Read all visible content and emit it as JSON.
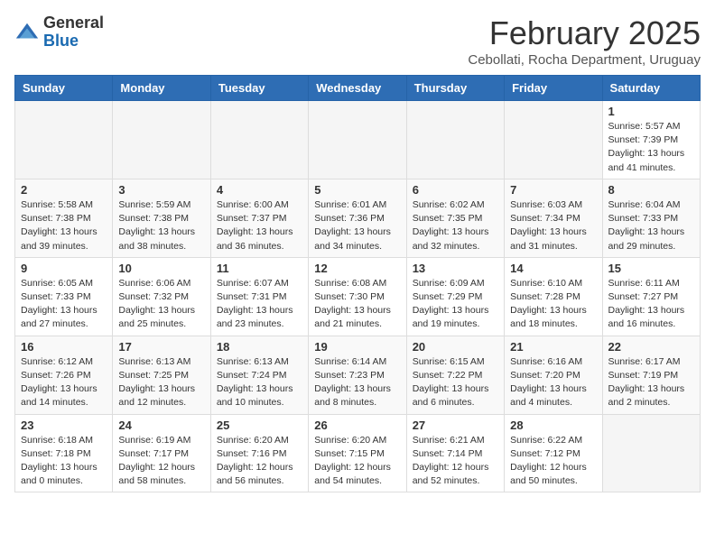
{
  "logo": {
    "general": "General",
    "blue": "Blue"
  },
  "header": {
    "title": "February 2025",
    "subtitle": "Cebollati, Rocha Department, Uruguay"
  },
  "weekdays": [
    "Sunday",
    "Monday",
    "Tuesday",
    "Wednesday",
    "Thursday",
    "Friday",
    "Saturday"
  ],
  "weeks": [
    [
      {
        "day": "",
        "info": ""
      },
      {
        "day": "",
        "info": ""
      },
      {
        "day": "",
        "info": ""
      },
      {
        "day": "",
        "info": ""
      },
      {
        "day": "",
        "info": ""
      },
      {
        "day": "",
        "info": ""
      },
      {
        "day": "1",
        "info": "Sunrise: 5:57 AM\nSunset: 7:39 PM\nDaylight: 13 hours\nand 41 minutes."
      }
    ],
    [
      {
        "day": "2",
        "info": "Sunrise: 5:58 AM\nSunset: 7:38 PM\nDaylight: 13 hours\nand 39 minutes."
      },
      {
        "day": "3",
        "info": "Sunrise: 5:59 AM\nSunset: 7:38 PM\nDaylight: 13 hours\nand 38 minutes."
      },
      {
        "day": "4",
        "info": "Sunrise: 6:00 AM\nSunset: 7:37 PM\nDaylight: 13 hours\nand 36 minutes."
      },
      {
        "day": "5",
        "info": "Sunrise: 6:01 AM\nSunset: 7:36 PM\nDaylight: 13 hours\nand 34 minutes."
      },
      {
        "day": "6",
        "info": "Sunrise: 6:02 AM\nSunset: 7:35 PM\nDaylight: 13 hours\nand 32 minutes."
      },
      {
        "day": "7",
        "info": "Sunrise: 6:03 AM\nSunset: 7:34 PM\nDaylight: 13 hours\nand 31 minutes."
      },
      {
        "day": "8",
        "info": "Sunrise: 6:04 AM\nSunset: 7:33 PM\nDaylight: 13 hours\nand 29 minutes."
      }
    ],
    [
      {
        "day": "9",
        "info": "Sunrise: 6:05 AM\nSunset: 7:33 PM\nDaylight: 13 hours\nand 27 minutes."
      },
      {
        "day": "10",
        "info": "Sunrise: 6:06 AM\nSunset: 7:32 PM\nDaylight: 13 hours\nand 25 minutes."
      },
      {
        "day": "11",
        "info": "Sunrise: 6:07 AM\nSunset: 7:31 PM\nDaylight: 13 hours\nand 23 minutes."
      },
      {
        "day": "12",
        "info": "Sunrise: 6:08 AM\nSunset: 7:30 PM\nDaylight: 13 hours\nand 21 minutes."
      },
      {
        "day": "13",
        "info": "Sunrise: 6:09 AM\nSunset: 7:29 PM\nDaylight: 13 hours\nand 19 minutes."
      },
      {
        "day": "14",
        "info": "Sunrise: 6:10 AM\nSunset: 7:28 PM\nDaylight: 13 hours\nand 18 minutes."
      },
      {
        "day": "15",
        "info": "Sunrise: 6:11 AM\nSunset: 7:27 PM\nDaylight: 13 hours\nand 16 minutes."
      }
    ],
    [
      {
        "day": "16",
        "info": "Sunrise: 6:12 AM\nSunset: 7:26 PM\nDaylight: 13 hours\nand 14 minutes."
      },
      {
        "day": "17",
        "info": "Sunrise: 6:13 AM\nSunset: 7:25 PM\nDaylight: 13 hours\nand 12 minutes."
      },
      {
        "day": "18",
        "info": "Sunrise: 6:13 AM\nSunset: 7:24 PM\nDaylight: 13 hours\nand 10 minutes."
      },
      {
        "day": "19",
        "info": "Sunrise: 6:14 AM\nSunset: 7:23 PM\nDaylight: 13 hours\nand 8 minutes."
      },
      {
        "day": "20",
        "info": "Sunrise: 6:15 AM\nSunset: 7:22 PM\nDaylight: 13 hours\nand 6 minutes."
      },
      {
        "day": "21",
        "info": "Sunrise: 6:16 AM\nSunset: 7:20 PM\nDaylight: 13 hours\nand 4 minutes."
      },
      {
        "day": "22",
        "info": "Sunrise: 6:17 AM\nSunset: 7:19 PM\nDaylight: 13 hours\nand 2 minutes."
      }
    ],
    [
      {
        "day": "23",
        "info": "Sunrise: 6:18 AM\nSunset: 7:18 PM\nDaylight: 13 hours\nand 0 minutes."
      },
      {
        "day": "24",
        "info": "Sunrise: 6:19 AM\nSunset: 7:17 PM\nDaylight: 12 hours\nand 58 minutes."
      },
      {
        "day": "25",
        "info": "Sunrise: 6:20 AM\nSunset: 7:16 PM\nDaylight: 12 hours\nand 56 minutes."
      },
      {
        "day": "26",
        "info": "Sunrise: 6:20 AM\nSunset: 7:15 PM\nDaylight: 12 hours\nand 54 minutes."
      },
      {
        "day": "27",
        "info": "Sunrise: 6:21 AM\nSunset: 7:14 PM\nDaylight: 12 hours\nand 52 minutes."
      },
      {
        "day": "28",
        "info": "Sunrise: 6:22 AM\nSunset: 7:12 PM\nDaylight: 12 hours\nand 50 minutes."
      },
      {
        "day": "",
        "info": ""
      }
    ]
  ]
}
